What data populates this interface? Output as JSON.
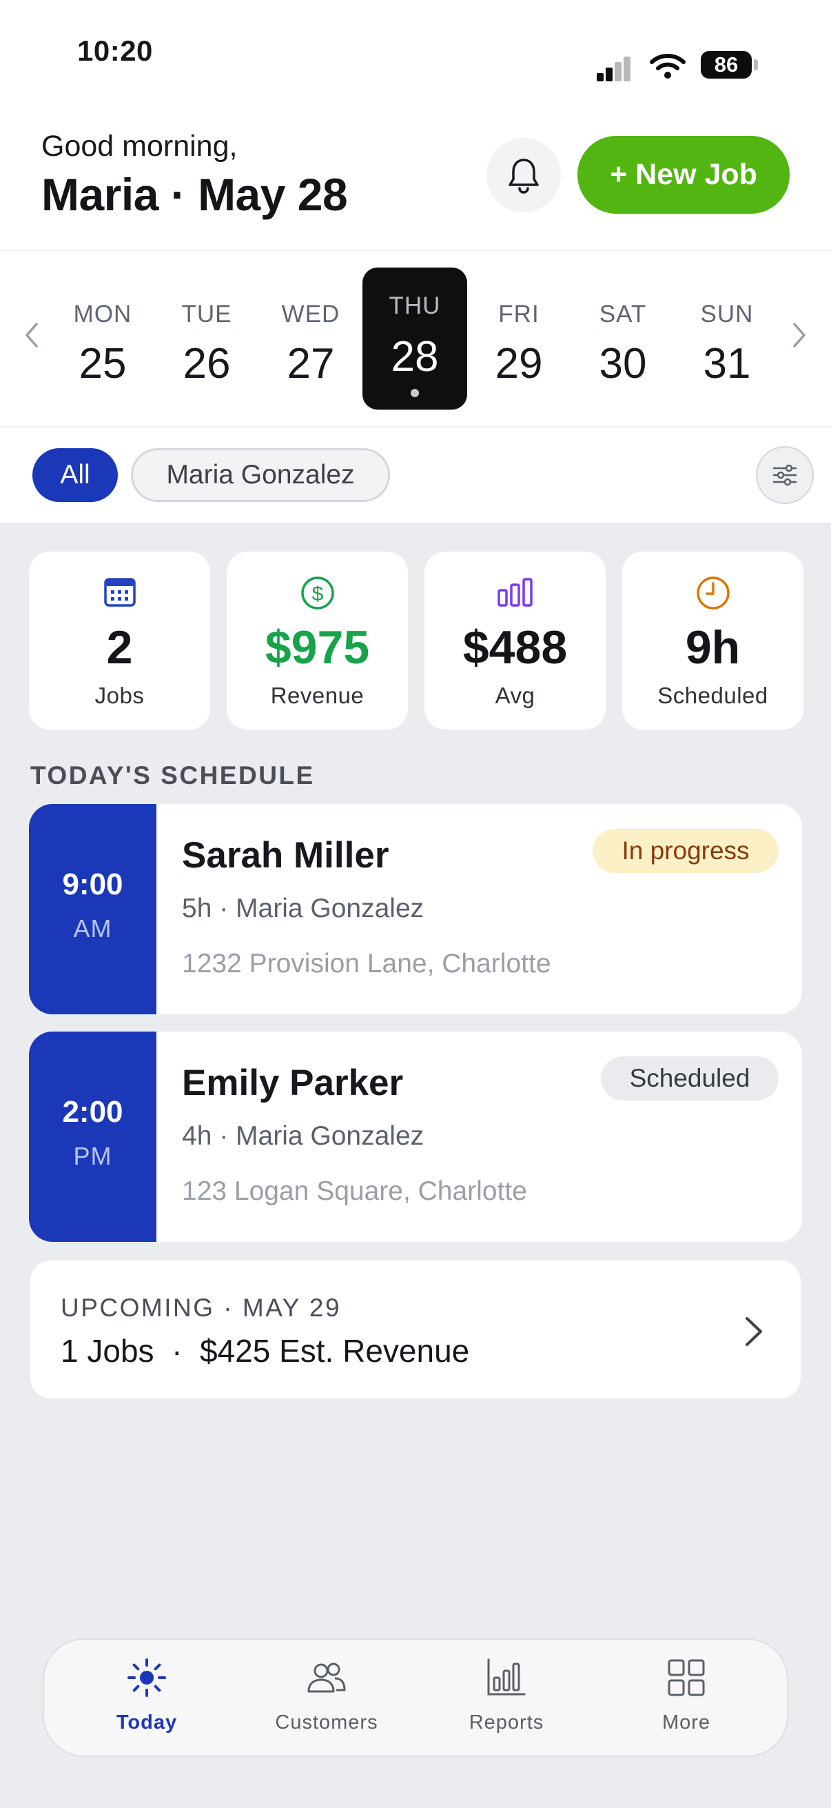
{
  "status_bar": {
    "time": "10:20",
    "battery": "86"
  },
  "header": {
    "greeting": "Good morning,",
    "headline": "Maria · May 28",
    "new_job_label": "+ New Job"
  },
  "week": {
    "days": [
      {
        "dow": "MON",
        "num": "25"
      },
      {
        "dow": "TUE",
        "num": "26"
      },
      {
        "dow": "WED",
        "num": "27"
      },
      {
        "dow": "THU",
        "num": "28",
        "selected": true
      },
      {
        "dow": "FRI",
        "num": "29"
      },
      {
        "dow": "SAT",
        "num": "30"
      },
      {
        "dow": "SUN",
        "num": "31"
      }
    ]
  },
  "filters": {
    "all": "All",
    "person": "Maria Gonzalez"
  },
  "stats": [
    {
      "value": "2",
      "label": "Jobs",
      "icon": "calendar-icon",
      "color": "#2443c2"
    },
    {
      "value": "$975",
      "label": "Revenue",
      "icon": "dollar-icon",
      "color": "#16a34a"
    },
    {
      "value": "$488",
      "label": "Avg",
      "icon": "bar-chart-icon",
      "color": "#7c3aed"
    },
    {
      "value": "9h",
      "label": "Scheduled",
      "icon": "clock-icon",
      "color": "#d97706"
    }
  ],
  "schedule": {
    "title": "TODAY'S SCHEDULE",
    "jobs": [
      {
        "time": "9:00",
        "ampm": "AM",
        "name": "Sarah Miller",
        "sub": "5h · Maria Gonzalez",
        "address": "1232 Provision Lane, Charlotte",
        "status": "In progress"
      },
      {
        "time": "2:00",
        "ampm": "PM",
        "name": "Emily Parker",
        "sub": "4h · Maria Gonzalez",
        "address": "123 Logan Square, Charlotte",
        "status": "Scheduled"
      }
    ]
  },
  "upcoming": {
    "label": "UPCOMING · MAY 29",
    "value": "1 Jobs  ·  $425 Est. Revenue"
  },
  "tabbar": {
    "items": [
      {
        "label": "Today",
        "icon": "sun-icon",
        "active": true
      },
      {
        "label": "Customers",
        "icon": "people-icon"
      },
      {
        "label": "Reports",
        "icon": "bar-chart-icon"
      },
      {
        "label": "More",
        "icon": "grid-icon"
      }
    ]
  },
  "colors": {
    "accent": "#1b38b8",
    "brand_green": "#52b512",
    "background": "#ebecf0"
  }
}
